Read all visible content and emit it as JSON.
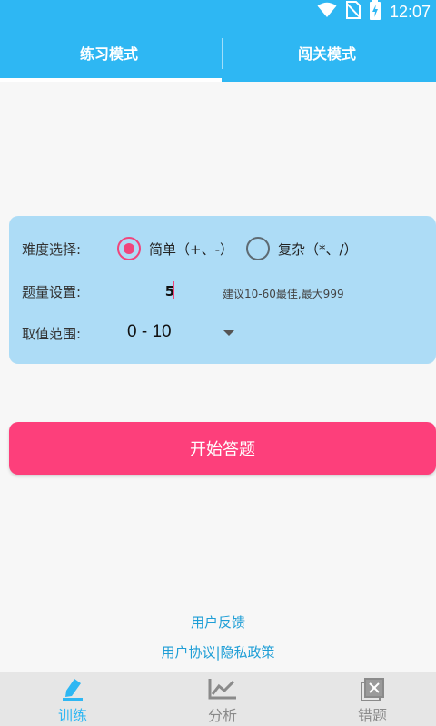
{
  "status_bar": {
    "time": "12:07",
    "icons": [
      "wifi-icon",
      "no-sim-icon",
      "battery-charging-icon"
    ]
  },
  "tabs": [
    {
      "label": "练习模式",
      "selected": true
    },
    {
      "label": "闯关模式",
      "selected": false
    }
  ],
  "settings": {
    "difficulty_label": "难度选择:",
    "options": [
      {
        "label": "简单（+、-）",
        "checked": true
      },
      {
        "label": "复杂（*、/）",
        "checked": false
      }
    ],
    "count_label": "题量设置:",
    "count_value": "5",
    "count_hint": "建议10-60最佳,最大999",
    "range_label": "取值范围:",
    "range_value": "0 - 10"
  },
  "start_button": "开始答题",
  "links": {
    "feedback": "用户反馈",
    "agreement": "用户协议|隐私政策"
  },
  "bottom_nav": [
    {
      "label": "训练",
      "icon": "pencil-icon",
      "active": true
    },
    {
      "label": "分析",
      "icon": "chart-icon",
      "active": false
    },
    {
      "label": "错题",
      "icon": "wrong-questions-icon",
      "active": false
    }
  ],
  "colors": {
    "primary": "#2eb7f3",
    "card": "#addcf6",
    "accent": "#fd3f7b",
    "link": "#1e9ed6",
    "nav_active": "#2eb7f3",
    "nav_inactive": "#8a8a8a"
  }
}
